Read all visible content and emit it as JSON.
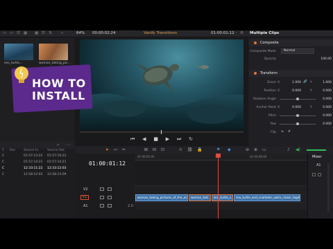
{
  "toolbar": {
    "zoom": "64%",
    "timecode_left": "00:00:02:24",
    "title": "Vanify Transitions",
    "timecode_right": "01:00:01:12",
    "inspector_title": "Multiple Clips"
  },
  "media_pool": {
    "thumbs": [
      {
        "label": "ses_turtle..."
      },
      {
        "label": "woman_taking_pic..."
      }
    ]
  },
  "overlay": {
    "line1": "HOW TO",
    "line2": "INSTALL"
  },
  "clip_list": {
    "columns": [
      "C",
      "Dur",
      "Source In",
      "Source Out"
    ],
    "rows": [
      {
        "c": "C",
        "dur": "",
        "in": "01:57:13:22",
        "out": "01:57:16:22",
        "selected": false
      },
      {
        "c": "C",
        "dur": "",
        "in": "01:57:14:21",
        "out": "01:57:14:21",
        "selected": false
      },
      {
        "c": "C",
        "dur": "",
        "in": "12:33:11:22",
        "out": "12:33:12:03",
        "selected": true
      },
      {
        "c": "C",
        "dur": "",
        "in": "12:58:12:03",
        "out": "12:58:13:09",
        "selected": false
      }
    ]
  },
  "inspector": {
    "composite": {
      "header": "Composite",
      "mode_label": "Composite Mode",
      "mode_value": "Normal",
      "opacity_label": "Opacity",
      "opacity_value": "100.00"
    },
    "transform": {
      "header": "Transform",
      "props": [
        {
          "label": "Zoom",
          "x_label": "X",
          "x": "1.000",
          "y_label": "Y",
          "y": "1.000"
        },
        {
          "label": "Position",
          "x_label": "X",
          "x": "0.000",
          "y_label": "Y",
          "y": "0.000"
        },
        {
          "label": "Rotation Angle",
          "value": "0.000"
        },
        {
          "label": "Anchor Point",
          "x_label": "X",
          "x": "0.000",
          "y_label": "Y",
          "y": "0.000"
        },
        {
          "label": "Pitch",
          "value": "0.000"
        },
        {
          "label": "Yaw",
          "value": "0.000"
        },
        {
          "label": "Flip",
          "value": ""
        }
      ]
    }
  },
  "timeline": {
    "timecode": "01:00:01:12",
    "ruler": [
      "01:00:00:00",
      "01:00:08:00"
    ],
    "tracks": [
      {
        "name": "V2"
      },
      {
        "name": "V1"
      },
      {
        "name": "A1",
        "extra": "2.0"
      }
    ],
    "clips": [
      {
        "label": "woman_taking_pictures_of_the_oce...",
        "selected": false
      },
      {
        "label": "woman_taki...",
        "selected": true
      },
      {
        "label": "sea_turtle_s...",
        "selected": true
      },
      {
        "label": "sea_turtle_and_snorkeler_swim_closer_toget...",
        "selected": false
      }
    ]
  },
  "mixer": {
    "title": "Mixer",
    "channel": "A1"
  }
}
